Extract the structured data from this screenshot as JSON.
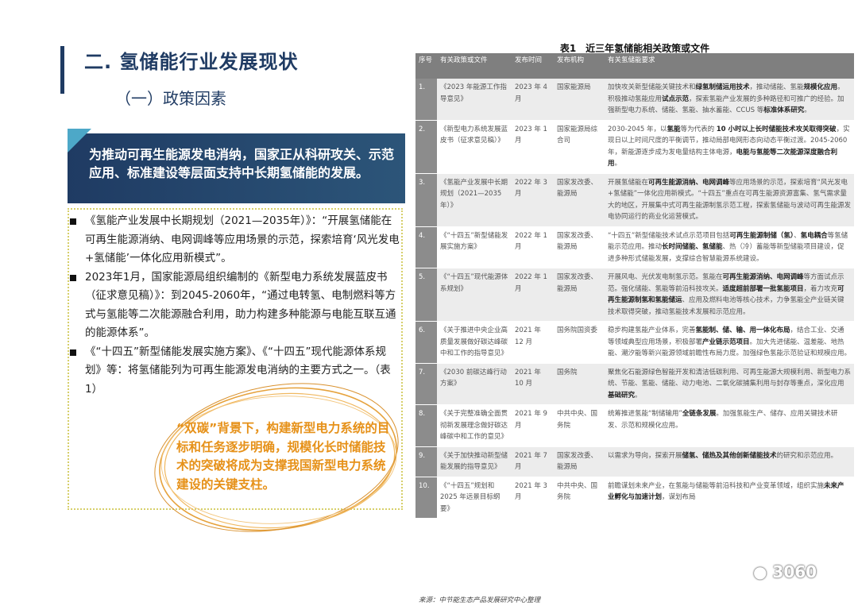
{
  "section": {
    "title": "二. 氢储能行业发展现状",
    "subtitle": "（一）政策因素"
  },
  "banner": {
    "text": "为推动可再生能源发电消纳，国家正从科研攻关、示范应用、标准建设等层面支持中长期氢储能的发展。"
  },
  "bullets": [
    "《氢能产业发展中长期规划（2021—2035年）》：“开展氢储能在可再生能源消纳、电网调峰等应用场景的示范，探索培育‘风光发电+氢储能’一体化应用新模式”。",
    "2023年1月，国家能源局组织编制的《新型电力系统发展蓝皮书（征求意见稿）》：到2045-2060年，“通过电转氢、电制燃料等方式与氢能等二次能源融合利用，助力构建多种能源与电能互联互通的能源体系”。",
    "《“十四五”新型储能发展实施方案》、《“十四五”现代能源体系规划》等：将氢储能列为可再生能源发电消纳的主要方式之一。（表1）"
  ],
  "highlight": "“双碳”背景下，构建新型电力系统的目标和任务逐步明确，规模化长时储能技术的突破将成为支撑我国新型电力系统建设的关键支柱。",
  "table": {
    "caption": "表1　近三年氢储能相关政策或文件",
    "headers": {
      "no": "序号",
      "doc": "有关政策或文件",
      "date": "发布时间",
      "org": "发布机构",
      "req": "有关氢储能要求"
    },
    "rows": [
      {
        "no": "1.",
        "doc": "《2023 年能源工作指导意见》",
        "date": "2023 年 4 月",
        "org": "国家能源局",
        "req": [
          [
            "加快攻关新型储能关键技术和",
            false
          ],
          [
            "绿氢制储运用技术",
            true
          ],
          [
            "，推动储能、氢能",
            false
          ],
          [
            "规模化应用",
            true
          ],
          [
            "。积极推动氢能应用",
            false
          ],
          [
            "试点示范",
            true
          ],
          [
            "，探索氢能产业发展的多种路径和可推广的经验。加强新型电力系统、储能、氢能、抽水蓄能、CCUS 等",
            false
          ],
          [
            "标准体系研究",
            true
          ],
          [
            "。",
            false
          ]
        ]
      },
      {
        "no": "2.",
        "doc": "《新型电力系统发展蓝皮书（征求意见稿）》",
        "date": "2023 年 1 月",
        "org": "国家能源局综合司",
        "req": [
          [
            "2030-2045 年，以",
            false
          ],
          [
            "氢能",
            true
          ],
          [
            "等为代表的 ",
            false
          ],
          [
            "10 小时以上长时储能技术攻关取得突破",
            true
          ],
          [
            "，实现日以上时间尺度的平衡调节，推动局部电网形态向动态平衡过渡。2045-2060 年，新能源逐步成为发电量结构主体电源，",
            false
          ],
          [
            "电能与氢能等二次能源深度融合利用",
            true
          ],
          [
            "。",
            false
          ]
        ]
      },
      {
        "no": "3.",
        "doc": "《氢能产业发展中长期规划（2021—2035 年）》",
        "date": "2022 年 3 月",
        "org": "国家发改委、能源局",
        "req": [
          [
            "开展氢储能在",
            false
          ],
          [
            "可再生能源消纳、电网调峰",
            true
          ],
          [
            "等应用场景的示范，探索培育“风光发电+氢储能”一体化应用新模式。“十四五”重点在可再生能源资源富集、氢气需求量大的地区，开展集中式可再生能源制氢示范工程，探索氢储能与波动可再生能源发电协同运行的商业化运营模式。",
            false
          ]
        ]
      },
      {
        "no": "4.",
        "doc": "《“十四五”新型储能发展实施方案》",
        "date": "2022 年 1 月",
        "org": "国家发改委、能源局",
        "req": [
          [
            "“十四五”新型储能技术试点示范项目包括",
            false
          ],
          [
            "可再生能源制储（氢）",
            true
          ],
          [
            "、",
            false
          ],
          [
            "氢电耦合",
            true
          ],
          [
            "等氢储能示范应用。推动",
            false
          ],
          [
            "长时间储能、氢储能",
            true
          ],
          [
            "、热（冷）蓄能等新型储能项目建设，促进多种形式储能发展，支撑综合智慧能源系统建设。",
            false
          ]
        ]
      },
      {
        "no": "5.",
        "doc": "《“十四五”现代能源体系规划》",
        "date": "2022 年 1 月",
        "org": "国家发改委、能源局",
        "req": [
          [
            "开展风电、光伏发电制氢示范。氢能在",
            false
          ],
          [
            "可再生能源消纳、电网调峰",
            true
          ],
          [
            "等方面试点示范。强化储能、氢能等前沿科技攻关。",
            false
          ],
          [
            "适度超前部署一批氢能项目",
            true
          ],
          [
            "，着力攻克",
            false
          ],
          [
            "可再生能源制氢和氢能储运",
            true
          ],
          [
            "、应用及燃料电池等核心技术，力争氢能全产业链关键技术取得突破，推动氢能技术发展和示范应用。",
            false
          ]
        ]
      },
      {
        "no": "6.",
        "doc": "《关于推进中央企业高质量发展做好碳达峰碳中和工作的指导意见》",
        "date": "2021 年 12 月",
        "org": "国务院国资委",
        "req": [
          [
            "稳步构建氢能产业体系，完善",
            false
          ],
          [
            "氢能制、储、输、用一体化布局",
            true
          ],
          [
            "，结合工业、交通等领域典型应用场景，积极部署",
            false
          ],
          [
            "产业链示范项目",
            true
          ],
          [
            "。加大先进储能、温差能、地热能、潮汐能等新兴能源领域前瞻性布局力度。加强绿色氢能示范验证和规模应用。",
            false
          ]
        ]
      },
      {
        "no": "7.",
        "doc": "《2030 前碳达峰行动方案》",
        "date": "2021 年 10 月",
        "org": "国务院",
        "req": [
          [
            "聚焦化石能源绿色智能开发和清洁低碳利用、可再生能源大规模利用、新型电力系统、节能、氢能、储能、动力电池、二氧化碳捕集利用与封存等重点，深化应用",
            false
          ],
          [
            "基础研究",
            true
          ],
          [
            "。",
            false
          ]
        ]
      },
      {
        "no": "8.",
        "doc": "《关于完整准确全面贯彻新发展理念做好碳达峰碳中和工作的意见》",
        "date": "2021 年 9 月",
        "org": "中共中央、国务院",
        "req": [
          [
            "统筹推进氢能“制储输用”",
            false
          ],
          [
            "全链条发展",
            true
          ],
          [
            "。加强氢能生产、储存、应用关键技术研发、示范和规模化应用。",
            false
          ]
        ]
      },
      {
        "no": "9.",
        "doc": "《关于加快推动新型储能发展的指导意见》",
        "date": "2021 年 7 月",
        "org": "国家发改委、能源局",
        "req": [
          [
            "以需求为导向，探索开展",
            false
          ],
          [
            "储氢、储热及其他创新储能技术",
            true
          ],
          [
            "的研究和示范应用。",
            false
          ]
        ]
      },
      {
        "no": "10.",
        "doc": "《“十四五”规划和 2025 年远景目标纲要》",
        "date": "2021 年 3 月",
        "org": "中共中央、国务院",
        "req": [
          [
            "前瞻谋划未来产业，在氢能与储能等前沿科技和产业变革领域，组织实施",
            false
          ],
          [
            "未来产业孵化与加速计划",
            true
          ],
          [
            "，谋划布局",
            false
          ]
        ]
      }
    ],
    "source": "来源：中节能生态产品发展研究中心整理"
  },
  "watermark": "3060"
}
